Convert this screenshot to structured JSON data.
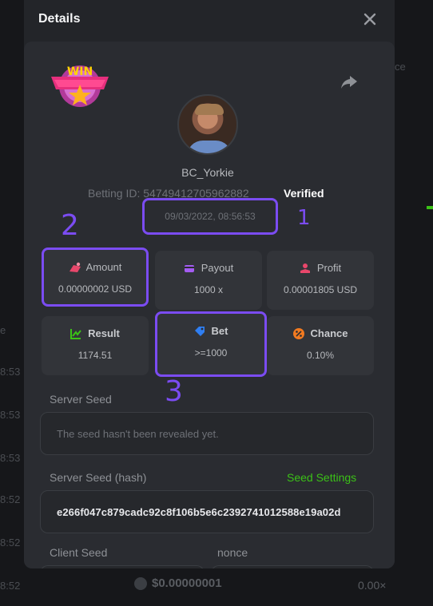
{
  "background": {
    "times": [
      "8:53",
      "8:53",
      "8:53",
      "8:52",
      "8:52",
      "8:52"
    ],
    "side_label": "e",
    "footer_amount": "$0.00000001",
    "footer_payout": "0.00×",
    "top_fragment": "ce"
  },
  "modal": {
    "title": "Details",
    "badge_text": "WIN",
    "username": "BC_Yorkie",
    "betting_id": "Betting ID: 54749412705962882",
    "verified": "Verified",
    "datetime": "09/03/2022, 08:56:53"
  },
  "annotations": [
    "1",
    "2",
    "3"
  ],
  "stats": [
    {
      "label": "Amount",
      "value": "0.00000002 USD",
      "icon": "amount-icon",
      "color": "#e8476b"
    },
    {
      "label": "Payout",
      "value": "1000 x",
      "icon": "payout-icon",
      "color": "#a45cf2"
    },
    {
      "label": "Profit",
      "value": "0.00001805 USD",
      "icon": "profit-icon",
      "color": "#e8476b"
    },
    {
      "label": "Result",
      "value": "1174.51",
      "icon": "result-icon",
      "color": "#3bc117"
    },
    {
      "label": "Bet",
      "value": ">=1000",
      "icon": "bet-icon",
      "color": "#2f7ef2"
    },
    {
      "label": "Chance",
      "value": "0.10%",
      "icon": "chance-icon",
      "color": "#f27a20"
    }
  ],
  "seeds": {
    "server_seed_label": "Server Seed",
    "server_seed_placeholder": "The seed hasn't been revealed yet.",
    "server_seed_hash_label": "Server Seed (hash)",
    "seed_settings": "Seed Settings",
    "server_seed_hash": "e266f047c879cadc92c8f106b5e6c2392741012588e19a02d",
    "client_seed_label": "Client Seed",
    "nonce_label": "nonce"
  },
  "colors": {
    "accent_purple": "#7b4cf2",
    "green": "#3bc117"
  }
}
